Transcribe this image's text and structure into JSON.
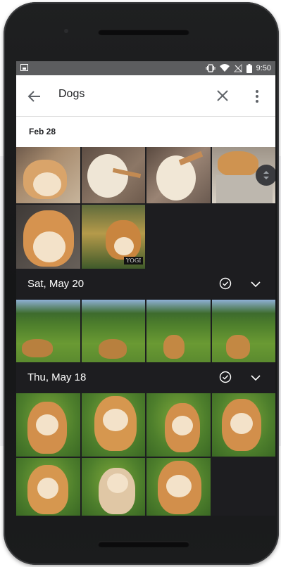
{
  "status_bar": {
    "time": "9:50",
    "icons": [
      "image-notification-icon",
      "vibrate-icon",
      "wifi-icon",
      "no-signal-icon",
      "battery-icon"
    ]
  },
  "app_bar": {
    "search_query": "Dogs",
    "back_icon": "arrow-back-icon",
    "clear_icon": "close-icon",
    "more_icon": "more-vert-icon"
  },
  "sections": [
    {
      "date": "Feb 28",
      "photo_count": 6
    },
    {
      "date": "Sat, May 20",
      "photo_count": 4
    },
    {
      "date": "Thu, May 18",
      "photo_count": 7
    }
  ],
  "photo_caption": "YOGI",
  "colors": {
    "appbar_bg": "#ffffff",
    "grid_bg": "#1d1d20",
    "status_bar_bg": "#5c5d5f"
  }
}
